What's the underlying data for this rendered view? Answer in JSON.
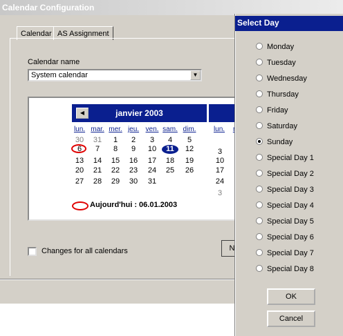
{
  "window": {
    "title": "Calendar Configuration"
  },
  "tabs": [
    {
      "label": "Calendar"
    },
    {
      "label": "AS Assignment"
    }
  ],
  "calendar_name": {
    "label": "Calendar name",
    "value": "System calendar"
  },
  "calendar": {
    "month_label": "janvier 2003",
    "weekdays": [
      "lun.",
      "mar.",
      "mer.",
      "jeu.",
      "ven.",
      "sam.",
      "dim."
    ],
    "next_weekdays": [
      "lun.",
      "m"
    ],
    "rows": [
      [
        "30",
        "31",
        "1",
        "2",
        "3",
        "4",
        "5"
      ],
      [
        "6",
        "7",
        "8",
        "9",
        "10",
        "11",
        "12"
      ],
      [
        "13",
        "14",
        "15",
        "16",
        "17",
        "18",
        "19"
      ],
      [
        "20",
        "21",
        "22",
        "23",
        "24",
        "25",
        "26"
      ],
      [
        "27",
        "28",
        "29",
        "30",
        "31",
        "",
        ""
      ]
    ],
    "next_rows": [
      "",
      "3",
      "10",
      "17",
      "24",
      "3"
    ],
    "selected_day": "11",
    "today_text": "Aujourd'hui : 06.01.2003"
  },
  "changes_all": {
    "label": "Changes for all calendars",
    "checked": false
  },
  "hidden_button_label": "N",
  "select_day": {
    "title": "Select Day",
    "options": [
      "Monday",
      "Tuesday",
      "Wednesday",
      "Thursday",
      "Friday",
      "Saturday",
      "Sunday",
      "Special Day 1",
      "Special Day 2",
      "Special Day 3",
      "Special Day 4",
      "Special Day 5",
      "Special Day 6",
      "Special Day 7",
      "Special Day 8"
    ],
    "selected": "Sunday",
    "ok_label": "OK",
    "cancel_label": "Cancel"
  }
}
